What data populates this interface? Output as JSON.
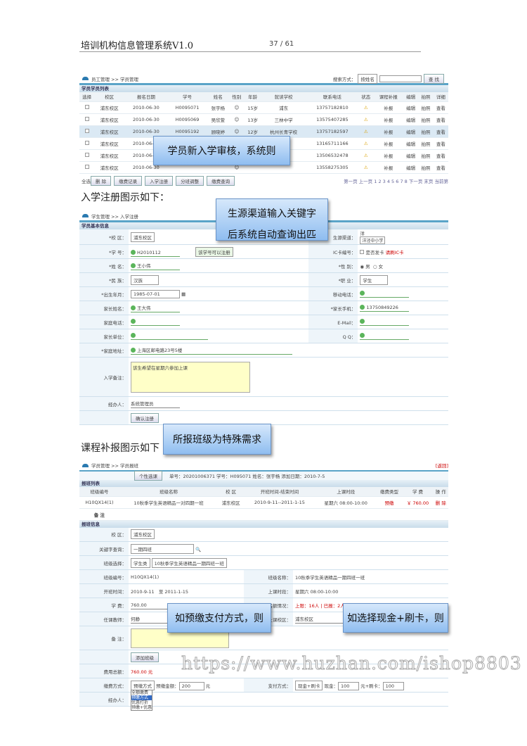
{
  "header": {
    "title": "培训机构信息管理系统V1.0",
    "page": "37 / 61"
  },
  "shot1": {
    "breadcrumb": "员工管理 >> 学员管理",
    "search_label": "搜索方式：",
    "search_mode": "按姓名",
    "search_btn": "查 找",
    "section": "学员学员列表",
    "columns": [
      "选择",
      "校区",
      "报名日期",
      "学号",
      "姓名",
      "性别",
      "年龄",
      "就读学校",
      "联系电话",
      "状态",
      "课程补报",
      "编辑",
      "拍照",
      "详细"
    ],
    "rows": [
      [
        "浦东校区",
        "2010-06-30",
        "H0095071",
        "张宇杨",
        "15岁",
        "浦东",
        "13757182810"
      ],
      [
        "浦东校区",
        "2010-06-30",
        "H0095069",
        "吴欣萱",
        "13岁",
        "三林中学",
        "13575407285"
      ],
      [
        "浦东校区",
        "2010-06-30",
        "H0095192",
        "顾晓婷",
        "12岁",
        "杭州长青学校",
        "13757182597"
      ],
      [
        "浦东校区",
        "2010-06-30",
        "",
        "",
        "",
        "",
        "13165711166"
      ],
      [
        "浦东校区",
        "2010-06-30",
        "",
        "",
        "",
        "",
        "13506532478"
      ],
      [
        "浦东校区",
        "2010-06-30",
        "",
        "",
        "",
        "",
        "13558275305"
      ]
    ],
    "row_actions": {
      "status": "⚠",
      "supplement": "补报",
      "edit": "编辑",
      "photo": "拍照",
      "detail": "查看"
    },
    "footer_buttons": [
      "全选",
      "删 除",
      "缴费记录",
      "入学注册",
      "分班调整",
      "缴费查询"
    ],
    "pagination": "第一页 上一页 1 2 3 4 5 6 7 8 下一页 末页 当前第",
    "callout": "学员新入学审核，系统则"
  },
  "caption2": "入学注册图示如下：",
  "shot2": {
    "breadcrumb": "学生管理 >> 入学注册",
    "section": "学员基本信息",
    "callout_line1": "生源渠道输入关键字",
    "callout_line2": "后系统自动查询出匹",
    "campus_label": "*校 区：",
    "campus": "浦东校区",
    "channel_label": "生源渠道：",
    "channel": "洋",
    "channel_suggest": "洋泾中小学",
    "sid_label": "*学 号：",
    "sid": "H2010112",
    "sid_hint": "该学号可以注册",
    "card_label": "IC卡编号：",
    "card_chk": "是否发卡",
    "card_hint": "请刷IC卡",
    "name_label": "*姓 名：",
    "name": "王小伟",
    "sex_label": "*性 别：",
    "male": "男",
    "female": "女",
    "nation_label": "*民 族：",
    "nation": "汉族",
    "job_label": "*职 业：",
    "job": "学生",
    "birth_label": "*出生年月：",
    "birth": "1985-07-01",
    "mobile_label": "移动电话：",
    "parent_label": "家长姓名：",
    "parent": "王大伟",
    "pmobile_label": "*家长手机：",
    "pmobile": "13750849226",
    "home_tel_label": "家庭电话：",
    "email_label": "E-Mail：",
    "work_label": "家长单位：",
    "qq_label": "Q Q：",
    "addr_label": "*家庭地址：",
    "addr": "上海区邮电路23号5楼",
    "remark_label": "入学备注：",
    "remark": "该生希望在星期六参加上课",
    "handler_label": "经办人：",
    "handler": "系统管理员",
    "submit": "确认注册"
  },
  "caption3": "课程补报图示如下",
  "callout3": "所报班级为特殊需求",
  "shot3": {
    "breadcrumb": "学员管理 >> 学员报班",
    "back": "[返回]",
    "btn_select": "个性选课",
    "info": "单号：20201006371  学号：H095071  姓名：张宇杨  添加日期：2010-7-5",
    "sec1": "报班列表",
    "columns": [
      "班级编号",
      "班级名称",
      "校 区",
      "开班时间-结束时间",
      "上课时段",
      "缴费类型",
      "学 费",
      "操 作"
    ],
    "row": [
      "H10QX14(1)",
      "10秋季学生英语精品一对四期一班",
      "浦东校区",
      "2010-9-11--2011-1-15",
      "星期六 08:00-10:00",
      "预缴",
      "￥ 760.00",
      "删 除"
    ],
    "remark": "备 注",
    "sec2": "报班信息",
    "campus_label": "校 区：",
    "campus": "浦东校区",
    "kw_label": "关键字查询：",
    "kw": "一期四班",
    "cls_label": "班级选择：",
    "cls_type": "学生类",
    "cls": "10秋季学生英语精品一期四班一班",
    "code_label": "班级编号：",
    "code": "H10QX14(1)",
    "cname_label": "班级名称：",
    "cname": "10秋季学生英语精品一期四班一班",
    "period_label": "开班时间：",
    "start": "2010-9-11",
    "to": "至",
    "end": "2011-1-15",
    "time_label": "上课时段：",
    "time": "星期六 08:00-10:00",
    "fee_label": "学 费：",
    "fee": "760.00",
    "yuan": "元",
    "quota_label": "名额情况：",
    "quota": "上限：16人 | 已报：2人",
    "teacher_label": "任课教师：",
    "teacher": "何静",
    "place_label": "上课校区：",
    "place": "浦东校区",
    "note_label": "备 注：",
    "add_btn": "添加班级",
    "total_label": "费用总额：",
    "total": "760.00 元",
    "pay_label": "缴费方式：",
    "pay": "预缴方式",
    "pre_label": "预缴金额：",
    "pre": "200",
    "pay2_label": "支付方式：",
    "pay2": "现金+刷卡",
    "cash_label": "现金：",
    "cash": "100",
    "card_label": "元+刷卡：",
    "card": "100",
    "options": [
      "全额缴费",
      "预缴方式",
      "优惠打折",
      "预缴+优惠"
    ],
    "agent_label": "经办人：",
    "callout_a": "如预缴支付方式，则",
    "callout_b": "如选择现金+刷卡，则"
  },
  "watermark": "https://www.huzhan.com/ishop8803"
}
